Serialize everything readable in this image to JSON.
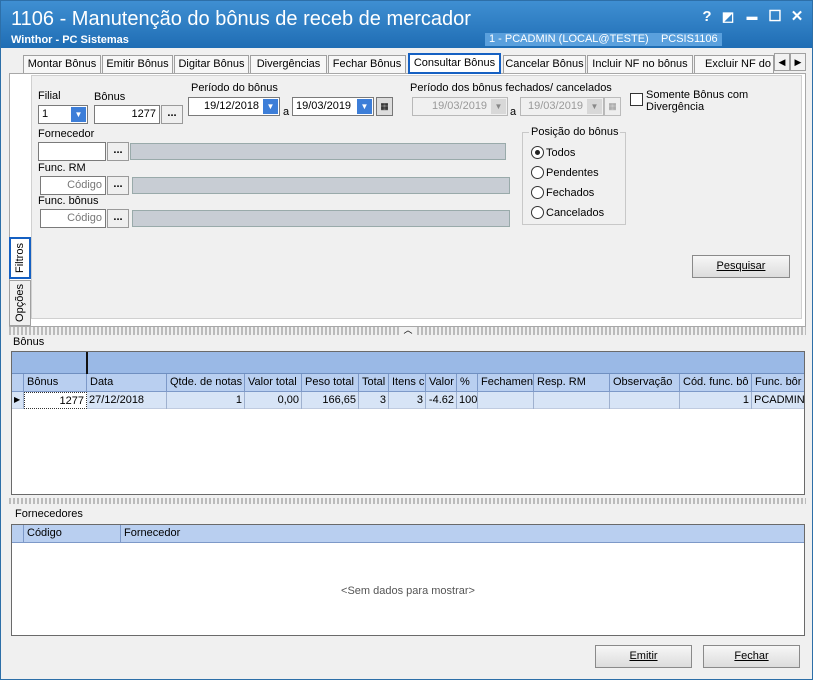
{
  "window": {
    "title": "1106 - Manutenção do bônus de receb de mercador",
    "subtitle": "Winthor - PC Sistemas",
    "user_info": "1 - PCADMIN (LOCAL@TESTE)",
    "routine_code": "PCSIS1106",
    "buttons": {
      "help": "?",
      "restore": "◩",
      "minimize": "▬",
      "maximize": "☐",
      "close": "✕"
    }
  },
  "tabs": [
    {
      "label": "Montar Bônus"
    },
    {
      "label": "Emitir Bônus"
    },
    {
      "label": "Digitar Bônus"
    },
    {
      "label": "Divergências"
    },
    {
      "label": "Fechar Bônus"
    },
    {
      "label": "Consultar Bônus"
    },
    {
      "label": "Cancelar Bônus"
    },
    {
      "label": "Incluir NF no bônus"
    },
    {
      "label": "Excluir NF do bônus"
    }
  ],
  "active_tab": "Consultar Bônus",
  "side_tabs": {
    "filtros": "Filtros",
    "opcoes": "Opções"
  },
  "filters": {
    "filial_label": "Filial",
    "filial_value": "1",
    "bonus_label": "Bônus",
    "bonus_value": "1277",
    "periodo_label": "Período do bônus",
    "periodo_ini": "19/12/2018",
    "periodo_sep": "a",
    "periodo_fim": "19/03/2019",
    "periodo_fechados_label": "Período dos bônus fechados/ cancelados",
    "fechados_ini": "19/03/2019",
    "fechados_sep": "a",
    "fechados_fim": "19/03/2019",
    "somente_div_label": "Somente Bônus com Divergência",
    "fornecedor_label": "Fornecedor",
    "func_rm_label": "Func. RM",
    "func_rm_placeholder": "Código",
    "func_bonus_label": "Func. bônus",
    "func_bonus_placeholder": "Código",
    "ellipsis": "...",
    "posicao_label": "Posição do bônus",
    "posicao_options": [
      "Todos",
      "Pendentes",
      "Fechados",
      "Cancelados"
    ],
    "posicao_selected": "Todos",
    "pesquisar_label": "Pesquisar"
  },
  "bonus_section": {
    "title": "Bônus",
    "columns": [
      "Bônus",
      "Data",
      "Qtde. de notas",
      "Valor total",
      "Peso total",
      "Total",
      "Itens c",
      "Valor",
      "%",
      "Fechamen",
      "Resp. RM",
      "Observação",
      "Cód. func. bô",
      "Func. bôr"
    ],
    "rows": [
      [
        "1277",
        "27/12/2018",
        "1",
        "0,00",
        "166,65",
        "3",
        "3",
        "-4.62",
        "100",
        "",
        "",
        "",
        "1",
        "PCADMIN"
      ]
    ]
  },
  "fornecedores_section": {
    "title": "Fornecedores",
    "columns": [
      "Código",
      "Fornecedor"
    ],
    "empty_message": "<Sem dados para mostrar>"
  },
  "footer": {
    "emitir_label": "Emitir",
    "fechar_label": "Fechar"
  },
  "colors": {
    "title_bar": "#2a7cc4",
    "active_tab_border": "#1560c2",
    "grid_header": "#b9cff0",
    "grid_row": "#d7e4f6"
  }
}
